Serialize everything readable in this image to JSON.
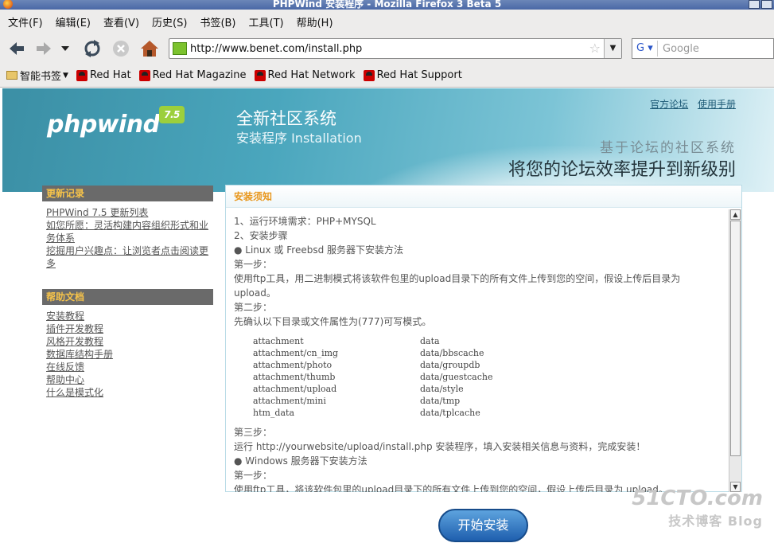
{
  "window": {
    "title": "PHPWind 安装程序 - Mozilla Firefox 3 Beta 5"
  },
  "menu": [
    "文件(F)",
    "编辑(E)",
    "查看(V)",
    "历史(S)",
    "书签(B)",
    "工具(T)",
    "帮助(H)"
  ],
  "nav": {
    "url": "http://www.benet.com/install.php",
    "search_engine": "G",
    "search_placeholder": "Google"
  },
  "bookmarks": [
    "智能书签",
    "Red Hat",
    "Red Hat Magazine",
    "Red Hat Network",
    "Red Hat Support"
  ],
  "banner": {
    "logo": "phpwind",
    "logo_version": "7.5",
    "title": "全新社区系统",
    "subtitle": "安装程序 Installation",
    "link_forum": "官方论坛",
    "link_manual": "使用手册",
    "slogan_small": "基于论坛的社区系统",
    "slogan_large": "将您的论坛效率提升到新级别"
  },
  "sidebar": {
    "updates_title": "更新记录",
    "updates": [
      "PHPWind 7.5 更新列表",
      "如您所愿：灵活构建内容组织形式和业务体系",
      "挖掘用户兴趣点：让浏览者点击阅读更多"
    ],
    "help_title": "帮助文档",
    "help": [
      "安装教程",
      "插件开发教程",
      "风格开发教程",
      "数据库结构手册",
      "在线反馈",
      "帮助中心",
      "什么是模式化"
    ]
  },
  "notice": {
    "title": "安装须知",
    "lines_top": [
      "1、运行环境需求：PHP+MYSQL",
      "2、安装步骤",
      "● Linux 或 Freebsd 服务器下安装方法",
      "第一步：",
      "使用ftp工具，用二进制模式将该软件包里的upload目录下的所有文件上传到您的空间，假设上传后目录为",
      "upload。",
      "第二步：",
      "先确认以下目录或文件属性为(777)可写模式。"
    ],
    "dirs_left": [
      "attachment",
      "attachment/cn_img",
      "attachment/photo",
      "attachment/thumb",
      "attachment/upload",
      "attachment/mini",
      "htm_data"
    ],
    "dirs_right": [
      "data",
      "data/bbscache",
      "data/groupdb",
      "data/guestcache",
      "data/style",
      "data/tmp",
      "data/tplcache"
    ],
    "lines_bottom": [
      "第三步：",
      "运行 http://yourwebsite/upload/install.php 安装程序，填入安装相关信息与资料，完成安装！",
      "● Windows 服务器下安装方法",
      "第一步：",
      "使用ftp工具，将该软件包里的upload目录下的所有文件上传到您的空间，假设上传后目录为 upload。"
    ]
  },
  "install_button": "开始安装",
  "watermark": {
    "line1": "51CTO.com",
    "line2": "技术博客 Blog"
  }
}
